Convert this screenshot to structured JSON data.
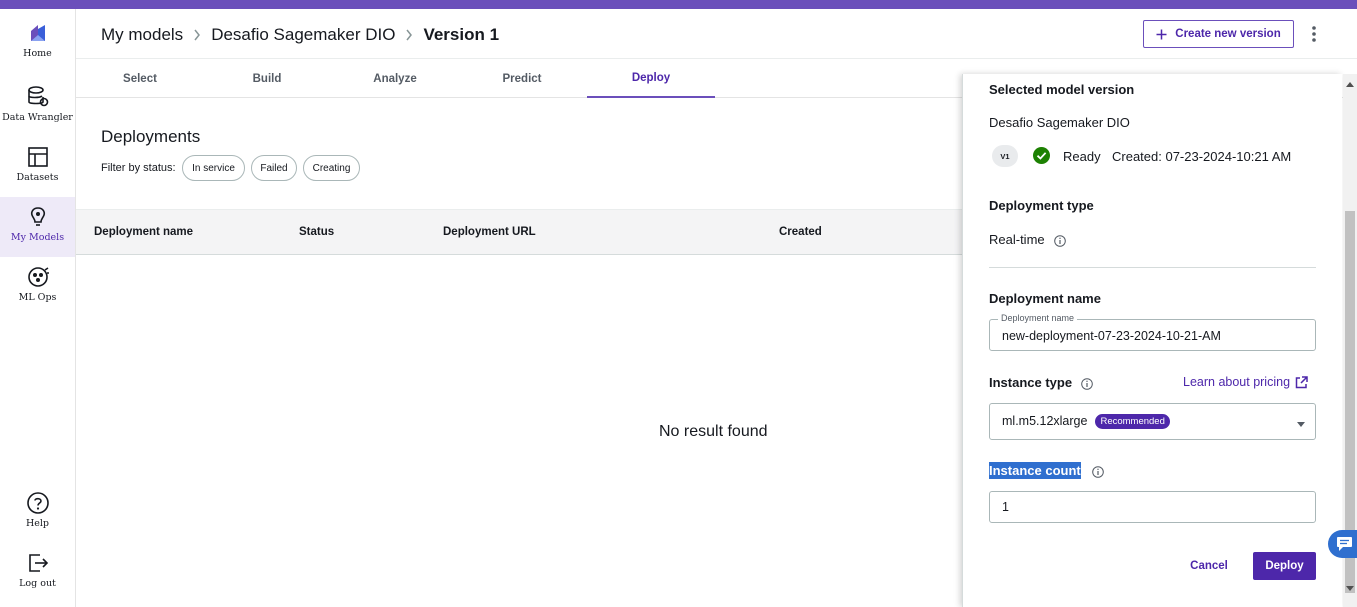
{
  "nav": {
    "home": "Home",
    "data_wrangler": "Data Wrangler",
    "datasets": "Datasets",
    "my_models": "My Models",
    "ml_ops": "ML Ops",
    "help": "Help",
    "logout": "Log out"
  },
  "breadcrumb": {
    "item1": "My models",
    "item2": "Desafio Sagemaker DIO",
    "current": "Version 1"
  },
  "header": {
    "create_label": "Create new version"
  },
  "tabs": [
    "Select",
    "Build",
    "Analyze",
    "Predict",
    "Deploy"
  ],
  "deployments": {
    "title": "Deployments",
    "filter_label": "Filter by status:",
    "filters": [
      "In service",
      "Failed",
      "Creating"
    ],
    "columns": [
      "Deployment name",
      "Status",
      "Deployment URL",
      "Created"
    ],
    "empty": "No result found"
  },
  "panel": {
    "selected_heading": "Selected model version",
    "model_name": "Desafio Sagemaker DIO",
    "version_badge": "V1",
    "status": "Ready",
    "created": "Created: 07-23-2024-10:21 AM",
    "type_heading": "Deployment type",
    "type_value": "Real-time",
    "name_heading": "Deployment name",
    "name_legend": "Deployment name",
    "name_value": "new-deployment-07-23-2024-10-21-AM",
    "instance_type_heading": "Instance type",
    "pricing_link": "Learn about pricing",
    "instance_type_value": "ml.m5.12xlarge",
    "recommended": "Recommended",
    "instance_count_heading": "Instance count",
    "instance_count_value": "1",
    "cancel": "Cancel",
    "deploy": "Deploy"
  },
  "colors": {
    "accent": "#4d27aa",
    "topbar": "#6b4fbb",
    "success": "#1d8102",
    "chat": "#2f6fcf"
  }
}
